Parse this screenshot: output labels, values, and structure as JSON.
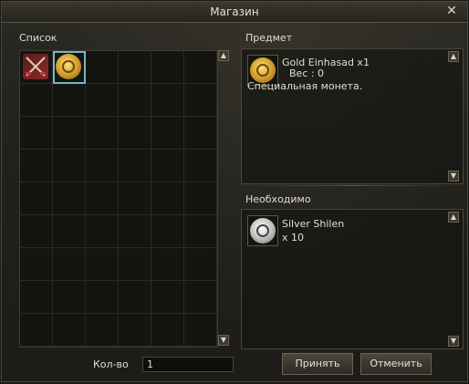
{
  "window": {
    "title": "Магазин",
    "close_glyph": "✕"
  },
  "list": {
    "label": "Список",
    "columns": 6,
    "rows": 9
  },
  "item_panel": {
    "label": "Предмет",
    "item_name": "Gold Einhasad x1",
    "weight": "Вес : 0",
    "description": "Специальная монета."
  },
  "required_panel": {
    "label": "Необходимо",
    "item_name": "Silver Shilen",
    "quantity": "x 10"
  },
  "quantity": {
    "label": "Кол-во",
    "value": "1"
  },
  "buttons": {
    "accept": "Принять",
    "cancel": "Отменить"
  },
  "icons": {
    "close": "close-icon",
    "sword": "crossed-swords-icon",
    "gold_coin": "gold-coin-icon",
    "silver_coin": "silver-coin-icon",
    "scroll_up": "arrow-up-icon",
    "scroll_down": "arrow-down-icon"
  },
  "colors": {
    "selection": "#6fb8c9",
    "background": "#22211c",
    "border": "#4a463a"
  }
}
